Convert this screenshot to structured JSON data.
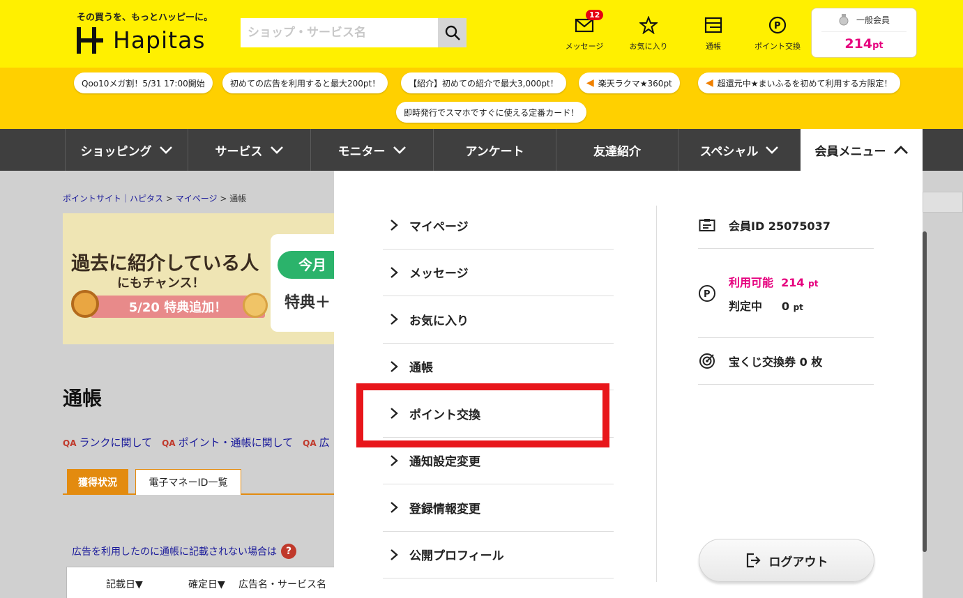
{
  "header": {
    "tagline": "その買うを、もっとハッピーに。",
    "brand": "Hapitas",
    "search_placeholder": "ショップ・サービス名",
    "nav": [
      {
        "label": "メッセージ",
        "icon": "mail-icon",
        "badge": "12"
      },
      {
        "label": "お気に入り",
        "icon": "star-icon"
      },
      {
        "label": "通帳",
        "icon": "passbook-icon"
      },
      {
        "label": "ポイント交換",
        "icon": "point-exchange-icon"
      }
    ],
    "member": {
      "rank": "一般会員",
      "points": "214",
      "unit": "pt"
    }
  },
  "campaigns": [
    "Qoo10メガ割！5/31 17:00開始",
    "初めての広告を利用すると最大200pt！",
    "【紹介】初めての紹介で最大3,000pt！",
    "楽天ラクマ★360pt",
    "超還元中★まいふるを初めて利用する方限定！",
    "即時発行でスマホですぐに使える定番カード！"
  ],
  "mainnav": [
    "ショッピング",
    "サービス",
    "モニター",
    "アンケート",
    "友達紹介",
    "スペシャル",
    "会員メニュー"
  ],
  "breadcrumb": {
    "home": "ポイントサイト｜ハピタス",
    "sep": ">",
    "mypage": "マイページ",
    "current": "通帳"
  },
  "banner": {
    "line1": "過去に紹介している人",
    "line2": "にもチャンス！",
    "ribbon": "5/20 特典追加！",
    "badge": "今月",
    "special": "特典＋"
  },
  "page": {
    "title": "通帳",
    "help_links": [
      "ランクに関して",
      "ポイント・通帳に関して",
      "広"
    ],
    "tabs": [
      "獲得状況",
      "電子マネーID一覧"
    ],
    "notice": "広告を利用したのに通帳に記載されない場合は",
    "table_headers": [
      "記載日▼",
      "確定日▼",
      "広告名・サービス名"
    ]
  },
  "dropdown": {
    "menu": [
      "マイページ",
      "メッセージ",
      "お気に入り",
      "通帳",
      "ポイント交換",
      "通知設定変更",
      "登録情報変更",
      "公開プロフィール"
    ],
    "member_id": "会員ID 25075037",
    "available_label": "利用可能",
    "available_value": "214",
    "pending_label": "判定中",
    "pending_value": "0",
    "pt_unit": "pt",
    "lottery": "宝くじ交換券 0 枚",
    "logout": "ログアウト"
  },
  "colors": {
    "header_yellow": "#fff000",
    "campaign_yellow": "#ffd000",
    "nav_dark": "#3f3f3f",
    "accent_pink": "#e6007e",
    "highlight_red": "#e8161b",
    "tab_orange": "#e38b0f"
  }
}
